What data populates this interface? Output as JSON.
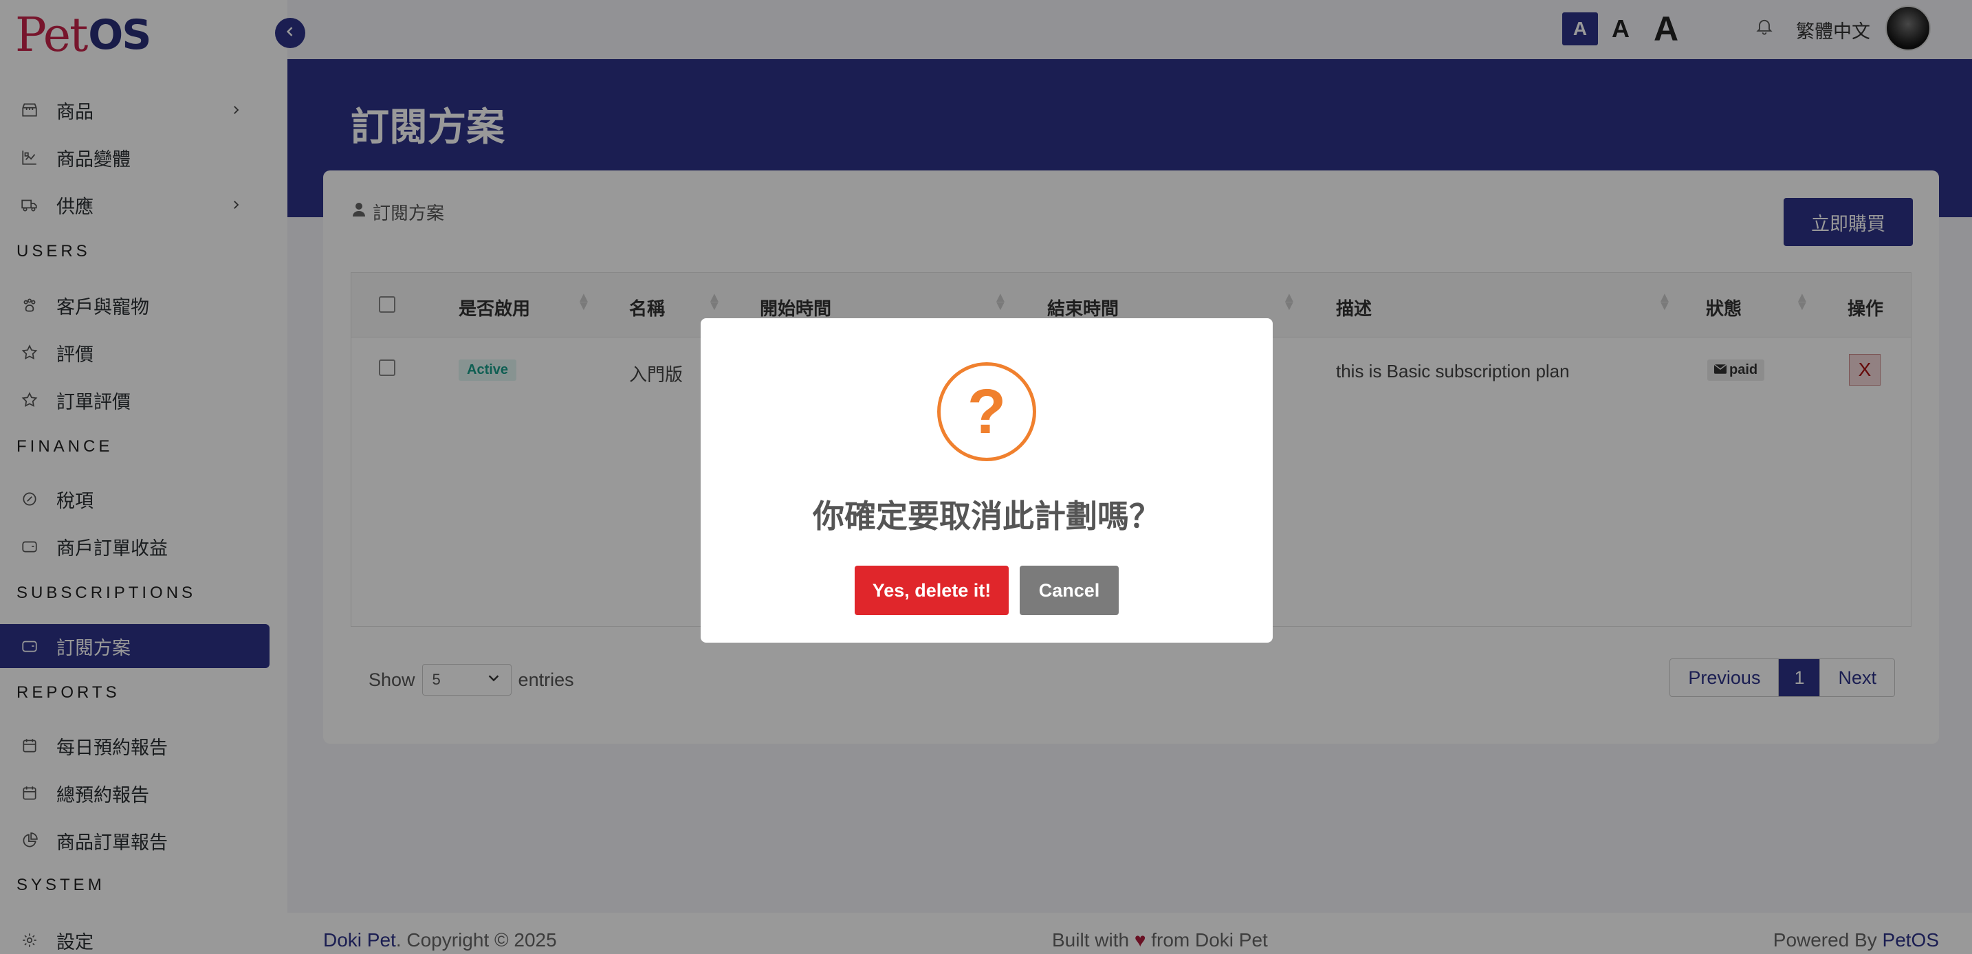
{
  "app": {
    "logo_pet": "Pet",
    "logo_os": "OS"
  },
  "sidebar": {
    "items": [
      {
        "label": "商品",
        "icon": "store-icon",
        "has_submenu": true
      },
      {
        "label": "商品變體",
        "icon": "variant-icon",
        "has_submenu": false
      },
      {
        "label": "供應",
        "icon": "truck-icon",
        "has_submenu": true
      },
      {
        "label": "客戶與寵物",
        "icon": "paw-icon",
        "has_submenu": false
      },
      {
        "label": "評價",
        "icon": "star-icon",
        "has_submenu": false
      },
      {
        "label": "訂單評價",
        "icon": "star-icon",
        "has_submenu": false
      },
      {
        "label": "稅項",
        "icon": "tax-icon",
        "has_submenu": false
      },
      {
        "label": "商戶訂單收益",
        "icon": "wallet-icon",
        "has_submenu": false
      },
      {
        "label": "訂閱方案",
        "icon": "wallet-icon",
        "active": true
      },
      {
        "label": "每日預約報告",
        "icon": "calendar-icon",
        "has_submenu": false
      },
      {
        "label": "總預約報告",
        "icon": "calendar-icon",
        "has_submenu": false
      },
      {
        "label": "商品訂單報告",
        "icon": "pie-chart-icon",
        "has_submenu": false
      },
      {
        "label": "設定",
        "icon": "gear-icon",
        "has_submenu": false
      }
    ],
    "sections": [
      "USERS",
      "FINANCE",
      "SUBSCRIPTIONS",
      "REPORTS",
      "SYSTEM"
    ]
  },
  "topbar": {
    "font_sizes": [
      "A",
      "A",
      "A"
    ],
    "language": "繁體中文"
  },
  "page": {
    "title": "訂閱方案",
    "card_title": "訂閱方案",
    "buy_button": "立即購買"
  },
  "table": {
    "headers": [
      "是否啟用",
      "名稱",
      "開始時間",
      "結束時間",
      "描述",
      "狀態",
      "操作"
    ],
    "rows": [
      {
        "enabled": "Active",
        "name": "入門版",
        "description": "this is Basic subscription plan",
        "status": "paid",
        "action": "X"
      }
    ]
  },
  "pagination": {
    "show_label": "Show",
    "page_size": "5",
    "entries_label": "entries",
    "previous": "Previous",
    "current": "1",
    "next": "Next"
  },
  "footer": {
    "brand": "Doki Pet",
    "copyright": ". Copyright © 2025",
    "built_prefix": "Built with",
    "built_suffix": "from Doki Pet",
    "powered_prefix": "Powered By",
    "powered_brand": "PetOS"
  },
  "modal": {
    "icon": "?",
    "title": "你確定要取消此計劃嗎？",
    "confirm": "Yes, delete it!",
    "cancel": "Cancel"
  },
  "colors": {
    "primary": "#2d3389",
    "danger": "#e0262b",
    "warning": "#f0802e"
  }
}
